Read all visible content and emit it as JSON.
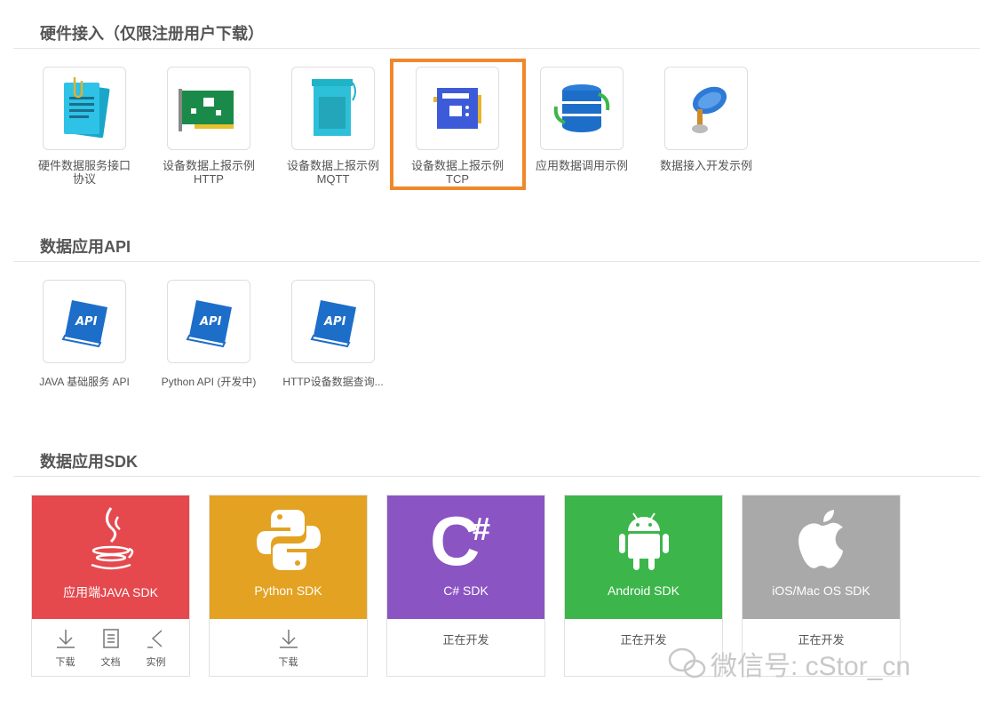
{
  "sections": {
    "hardware": "硬件接入（仅限注册用户下载）",
    "api": "数据应用API",
    "sdk": "数据应用SDK"
  },
  "hardware_tiles": [
    {
      "line1": "硬件数据服务接口",
      "line2": "协议",
      "icon": "document-clip-icon"
    },
    {
      "line1": "设备数据上报示例",
      "line2": "HTTP",
      "icon": "circuit-board-icon"
    },
    {
      "line1": "设备数据上报示例",
      "line2": "MQTT",
      "icon": "device-module-icon"
    },
    {
      "line1": "设备数据上报示例",
      "line2": "TCP",
      "icon": "chip-board-icon"
    },
    {
      "line1": "应用数据调用示例",
      "line2": "",
      "icon": "database-sync-icon"
    },
    {
      "line1": "数据接入开发示例",
      "line2": "",
      "icon": "satellite-dish-icon"
    }
  ],
  "api_tiles": [
    {
      "label": "JAVA 基础服务 API",
      "icon_text": "API"
    },
    {
      "label": "Python API (开发中)",
      "icon_text": "API"
    },
    {
      "label": "HTTP设备数据查询...",
      "icon_text": "API"
    }
  ],
  "sdk_cards": [
    {
      "name": "应用端JAVA SDK",
      "color": "#e5484d",
      "status": "",
      "actions": [
        "下载",
        "文档",
        "实例"
      ]
    },
    {
      "name": "Python SDK",
      "color": "#e3a221",
      "status": "",
      "actions": [
        "下载"
      ]
    },
    {
      "name": "C# SDK",
      "color": "#8b54c3",
      "status": "正在开发",
      "actions": []
    },
    {
      "name": "Android SDK",
      "color": "#3cb64a",
      "status": "正在开发",
      "actions": []
    },
    {
      "name": "iOS/Mac OS SDK",
      "color": "#a9a9a9",
      "status": "正在开发",
      "actions": []
    }
  ],
  "watermark": "微信号: cStor_cn"
}
